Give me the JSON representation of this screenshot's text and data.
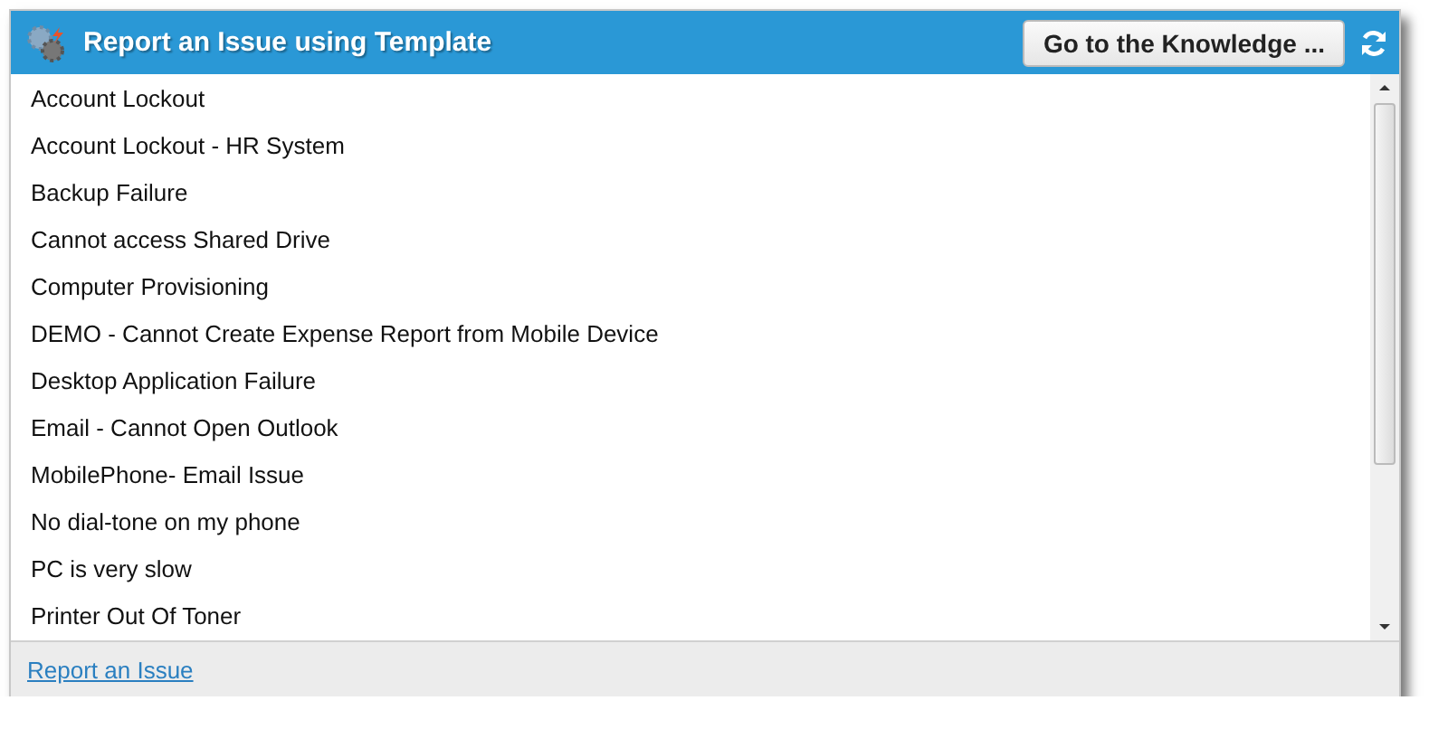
{
  "header": {
    "title": "Report an Issue using Template",
    "button": "Go to the Knowledge ..."
  },
  "templates": [
    {
      "label": "Account Lockout"
    },
    {
      "label": "Account Lockout - HR System"
    },
    {
      "label": "Backup Failure"
    },
    {
      "label": "Cannot access Shared Drive"
    },
    {
      "label": "Computer Provisioning"
    },
    {
      "label": "DEMO - Cannot Create Expense Report from Mobile Device"
    },
    {
      "label": "Desktop Application Failure"
    },
    {
      "label": "Email - Cannot Open Outlook"
    },
    {
      "label": "MobilePhone- Email Issue"
    },
    {
      "label": "No dial-tone on my phone"
    },
    {
      "label": "PC is very slow"
    },
    {
      "label": "Printer Out Of Toner"
    }
  ],
  "footer": {
    "link": "Report an Issue"
  }
}
